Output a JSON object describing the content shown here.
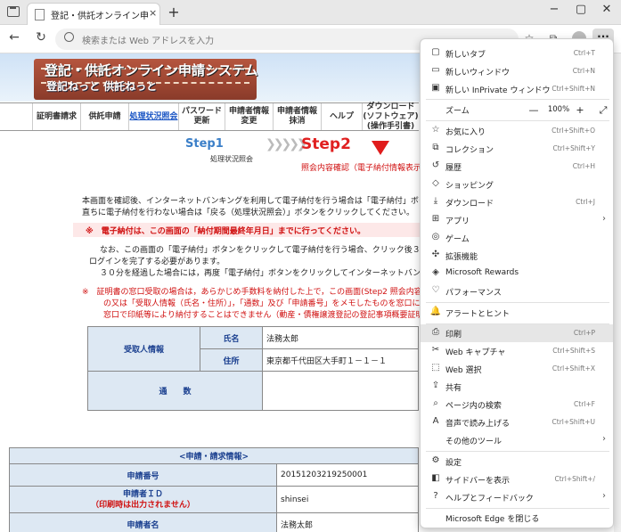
{
  "browser": {
    "tab_title": "登記・供託オンライン申請システム・",
    "tab_close": "×",
    "new_tab": "+",
    "address_placeholder": "検索または Web アドレスを入力",
    "more_label": "···"
  },
  "banner": {
    "title": "登記・供託オンライン申請システム",
    "subtitle": "登記ねっと 供託ねっと"
  },
  "nav": {
    "items": [
      "証明書請求",
      "供託申請",
      "処理状況照会",
      "パスワード 更新",
      "申請者情報 変更",
      "申請者情報 抹消",
      "ヘルプ",
      "ダウンロード (ソフトウェア) (操作手引書)"
    ],
    "active_index": 2
  },
  "steps": {
    "step1": "Step1",
    "step1_sub": "処理状況照会",
    "step2": "Step2",
    "step2_sub": "照会内容確認（電子納付情報表示"
  },
  "body": {
    "p1": "本画面を確認後、インターネットバンキングを利用して電子納付を行う場合は「電子納付」ボタンをク",
    "p2": "直ちに電子納付を行わない場合は「戻る（処理状況照会）」ボタンをクリックしてください。",
    "warn": "※　電子納付は、この画面の「納付期間最終年月日」までに行ってください。",
    "p3": "なお、この画面の「電子納付」ボタンをクリックして電子納付を行う場合、クリック後３０分以内",
    "p4": "ログインを完了する必要があります。",
    "p5": "３０分を経過した場合には，再度「電子納付」ボタンをクリックしてインターネットバンキングへロ",
    "n1": "※　証明書の窓口受取の場合は，あらかじめ手数料を納付した上で，この画面(Step2 照会内容確認)をプ",
    "n2": "の又は「受取人情報（氏名・住所）」，「通数」及び「申請番号」をメモしたものを窓口に提出して",
    "n3": "窓口で印紙等により納付することはできません（動産・債権譲渡登記の登記事項概要証明書を除く。"
  },
  "recipient": {
    "section": "受取人情報",
    "name_label": "氏名",
    "name_value": "法務太郎",
    "addr_label": "住所",
    "addr_value": "東京都千代田区大手町１－１－１",
    "count_label": "通　　数"
  },
  "application": {
    "header": "<申請・請求情報>",
    "rows": [
      {
        "label": "申請番号",
        "value": "20151203219250001"
      },
      {
        "label": "申請者ＩＤ",
        "label2": "（印刷時は出力されません）",
        "value": "shinsei"
      },
      {
        "label": "申請者名",
        "value": "法務太郎"
      }
    ]
  },
  "menu": {
    "zoom_label": "ズーム",
    "zoom_value": "100%",
    "items": [
      {
        "icon": "▢",
        "label": "新しいタブ",
        "shortcut": "Ctrl+T"
      },
      {
        "icon": "▭",
        "label": "新しいウィンドウ",
        "shortcut": "Ctrl+N"
      },
      {
        "icon": "▣",
        "label": "新しい InPrivate ウィンドウ",
        "shortcut": "Ctrl+Shift+N"
      },
      {
        "icon": "☆",
        "label": "お気に入り",
        "shortcut": "Ctrl+Shift+O"
      },
      {
        "icon": "⧉",
        "label": "コレクション",
        "shortcut": "Ctrl+Shift+Y"
      },
      {
        "icon": "↺",
        "label": "履歴",
        "shortcut": "Ctrl+H"
      },
      {
        "icon": "◇",
        "label": "ショッピング",
        "shortcut": ""
      },
      {
        "icon": "⤓",
        "label": "ダウンロード",
        "shortcut": "Ctrl+J"
      },
      {
        "icon": "⊞",
        "label": "アプリ",
        "shortcut": ""
      },
      {
        "icon": "◎",
        "label": "ゲーム",
        "shortcut": ""
      },
      {
        "icon": "✣",
        "label": "拡張機能",
        "shortcut": ""
      },
      {
        "icon": "◈",
        "label": "Microsoft Rewards",
        "shortcut": ""
      },
      {
        "icon": "♡",
        "label": "パフォーマンス",
        "shortcut": ""
      },
      {
        "icon": "🔔",
        "label": "アラートとヒント",
        "shortcut": ""
      },
      {
        "icon": "⎙",
        "label": "印刷",
        "shortcut": "Ctrl+P"
      },
      {
        "icon": "✂",
        "label": "Web キャプチャ",
        "shortcut": "Ctrl+Shift+S"
      },
      {
        "icon": "⬚",
        "label": "Web 選択",
        "shortcut": "Ctrl+Shift+X"
      },
      {
        "icon": "⇪",
        "label": "共有",
        "shortcut": ""
      },
      {
        "icon": "⌕",
        "label": "ページ内の検索",
        "shortcut": "Ctrl+F"
      },
      {
        "icon": "A",
        "label": "音声で読み上げる",
        "shortcut": "Ctrl+Shift+U"
      },
      {
        "icon": "",
        "label": "その他のツール",
        "shortcut": ""
      },
      {
        "icon": "⚙",
        "label": "設定",
        "shortcut": ""
      },
      {
        "icon": "◧",
        "label": "サイドバーを表示",
        "shortcut": "Ctrl+Shift+/"
      },
      {
        "icon": "?",
        "label": "ヘルプとフィードバック",
        "shortcut": ""
      },
      {
        "icon": "",
        "label": "Microsoft Edge を閉じる",
        "shortcut": ""
      }
    ]
  }
}
